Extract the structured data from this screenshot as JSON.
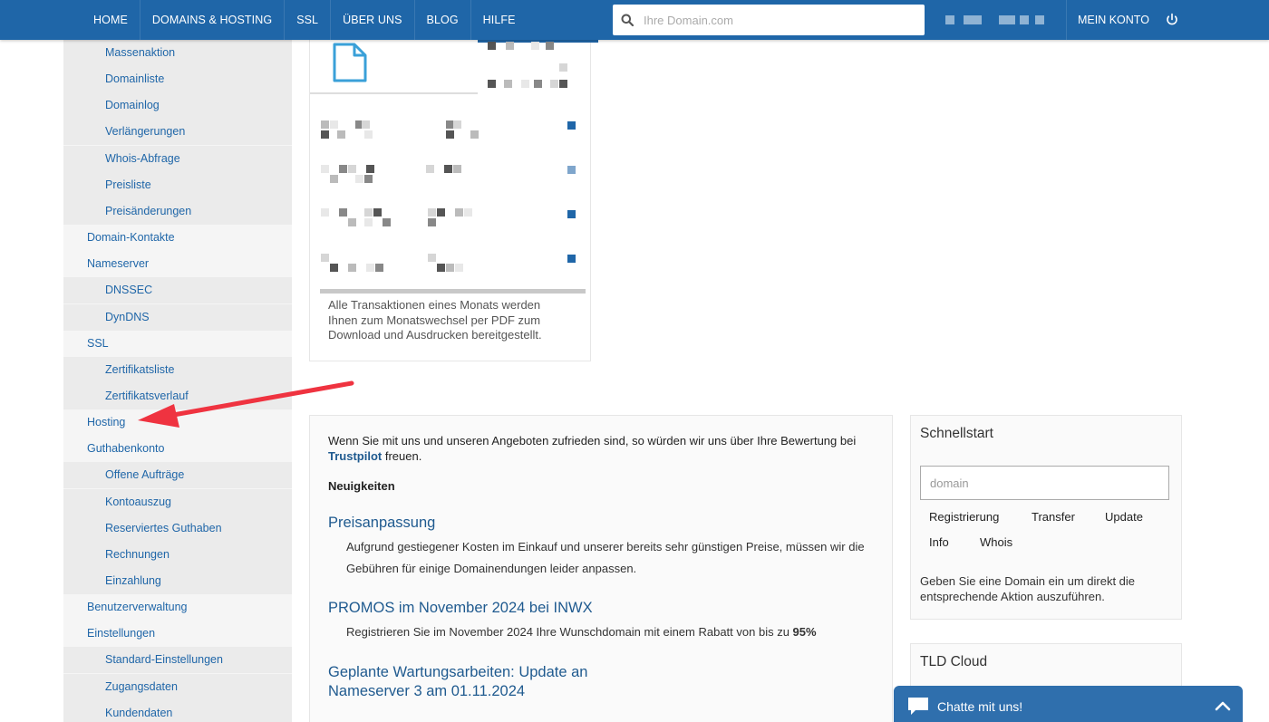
{
  "nav": {
    "items": [
      "HOME",
      "DOMAINS & HOSTING",
      "SSL",
      "ÜBER UNS",
      "BLOG",
      "HILFE"
    ],
    "search_placeholder": "Ihre Domain.com",
    "account": "MEIN KONTO"
  },
  "sidebar": {
    "items": [
      {
        "label": "Massenaktion",
        "level": 2
      },
      {
        "label": "Domainliste",
        "level": 2
      },
      {
        "label": "Domainlog",
        "level": 2
      },
      {
        "label": "Verlängerungen",
        "level": 2
      },
      {
        "label": "Whois-Abfrage",
        "level": 2
      },
      {
        "label": "Preisliste",
        "level": 2
      },
      {
        "label": "Preisänderungen",
        "level": 2
      },
      {
        "label": "Domain-Kontakte",
        "level": 1
      },
      {
        "label": "Nameserver",
        "level": 1
      },
      {
        "label": "DNSSEC",
        "level": 2
      },
      {
        "label": "DynDNS",
        "level": 2
      },
      {
        "label": "SSL",
        "level": 1
      },
      {
        "label": "Zertifikatsliste",
        "level": 2
      },
      {
        "label": "Zertifikatsverlauf",
        "level": 2
      },
      {
        "label": "Hosting",
        "level": 1
      },
      {
        "label": "Guthabenkonto",
        "level": 1
      },
      {
        "label": "Offene Aufträge",
        "level": 2
      },
      {
        "label": "Kontoauszug",
        "level": 2
      },
      {
        "label": "Reserviertes Guthaben",
        "level": 2
      },
      {
        "label": "Rechnungen",
        "level": 2
      },
      {
        "label": "Einzahlung",
        "level": 2
      },
      {
        "label": "Benutzerverwaltung",
        "level": 1
      },
      {
        "label": "Einstellungen",
        "level": 1
      },
      {
        "label": "Standard-Einstellungen",
        "level": 2
      },
      {
        "label": "Zugangsdaten",
        "level": 2
      },
      {
        "label": "Kundendaten",
        "level": 2
      }
    ]
  },
  "transactions": {
    "note": "Alle Transaktionen eines Monats werden Ihnen zum Monatswechsel per PDF zum Download und Ausdrucken bereitgestellt."
  },
  "news": {
    "intro_before": "Wenn Sie mit uns und unseren Angeboten zufrieden sind, so würden wir uns über Ihre Bewertung bei ",
    "intro_link": "Trustpilot",
    "intro_after": " freuen.",
    "label": "Neuigkeiten",
    "items": [
      {
        "title": "Preisanpassung",
        "text": "Aufgrund gestiegener Kosten im Einkauf und unserer bereits sehr günstigen Preise, müssen wir die Gebühren für einige Domainendungen leider anpassen."
      },
      {
        "title": "PROMOS im November 2024 bei INWX",
        "text_before": "Registrieren Sie im November 2024 Ihre Wunschdomain mit einem Rabatt von bis zu ",
        "text_bold": "95%"
      },
      {
        "title": "Geplante Wartungsarbeiten: Update an Nameserver 3 am 01.11.2024"
      }
    ]
  },
  "quickstart": {
    "title": "Schnellstart",
    "placeholder": "domain",
    "actions": [
      "Registrierung",
      "Transfer",
      "Update",
      "Info",
      "Whois"
    ],
    "help": "Geben Sie eine Domain ein um direkt die entsprechende Aktion auszuführen."
  },
  "tld": {
    "title": "TLD Cloud"
  },
  "chat": {
    "label": "Chatte mit uns!"
  },
  "colors": {
    "brand": "#1f66a8",
    "link": "#1f5a8f",
    "arrow": "#ef3340"
  }
}
